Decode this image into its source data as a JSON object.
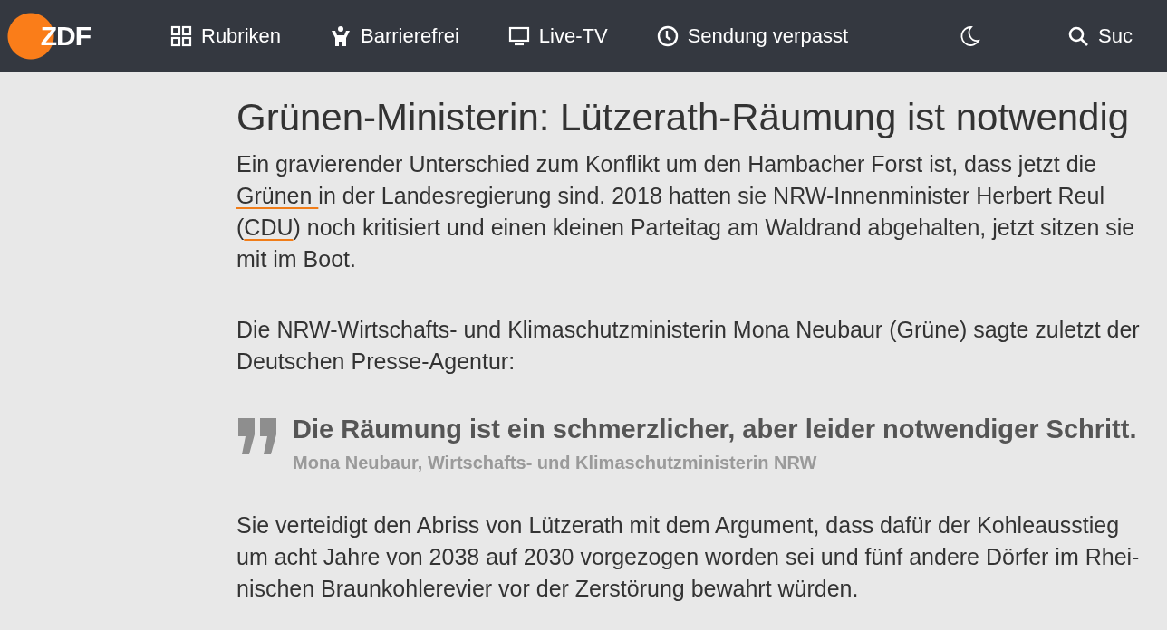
{
  "header": {
    "logo": "ZDF",
    "nav": [
      {
        "kind": "grid",
        "label": "Rubriken"
      },
      {
        "kind": "person",
        "label": "Barrierefrei"
      },
      {
        "kind": "tv",
        "label": "Live-TV"
      },
      {
        "kind": "clock",
        "label": "Sendung verpasst"
      },
      {
        "kind": "moon"
      },
      {
        "kind": "search",
        "label": "Suc"
      }
    ]
  },
  "article": {
    "title": "Grünen-Ministerin: Lützerath-Räumung ist notwendig",
    "blocks": [
      {
        "kind": "paragraph",
        "parts": [
          {
            "link": false,
            "text": "Ein gravierender Unterschied zum Konflikt um den Hambacher Forst ist, dass jetzt die "
          },
          {
            "link": true,
            "text": "Grünen "
          },
          {
            "link": false,
            "text": "in der Landesregierung sind. 2018 hatten sie NRW-Innenminister Herbert Reul ("
          },
          {
            "link": true,
            "text": "CDU"
          },
          {
            "link": false,
            "text": ") noch kritisiert und einen kleinen Parteitag am Waldrand abgehalten, jetzt sitzen sie mit im Boot."
          }
        ]
      },
      {
        "kind": "paragraph",
        "parts": [
          {
            "link": false,
            "text": "Die NRW-Wirtschafts- und Klimaschutzministerin Mona Neubaur (Grüne) sagte zuletzt der Deutschen Presse-Agentur:"
          }
        ]
      },
      {
        "kind": "quote",
        "text": "Die Räumung ist ein schmerzlicher, aber leider notwendiger Schritt.",
        "source": "Mona Neubaur, Wirtschafts- und Klimaschutzministerin NRW"
      },
      {
        "kind": "paragraph",
        "parts": [
          {
            "link": false,
            "text": "Sie verteidigt den Abriss von Lützerath mit dem Argument, dass dafür der Kohleausstieg um acht Jahre von 2038 auf 2030 vorgezogen worden sei und fünf andere Dörfer im Rhei-nischen Braunkohlerevier vor der Zerstörung bewahrt würden."
          }
        ]
      }
    ]
  }
}
